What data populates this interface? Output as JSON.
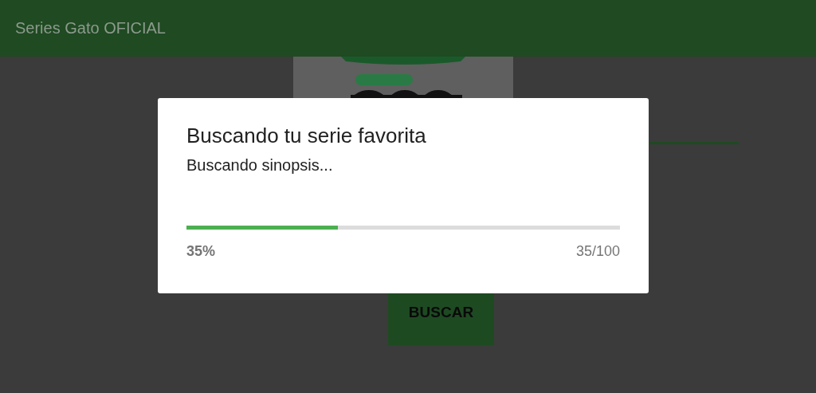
{
  "app_bar": {
    "title": "Series Gato OFICIAL"
  },
  "search_button": {
    "label": "BUSCAR"
  },
  "dialog": {
    "title": "Buscando tu serie favorita",
    "message": "Buscando sinopsis...",
    "progress": {
      "level": 0.35,
      "percent": "35%",
      "count": "35/100"
    }
  }
}
